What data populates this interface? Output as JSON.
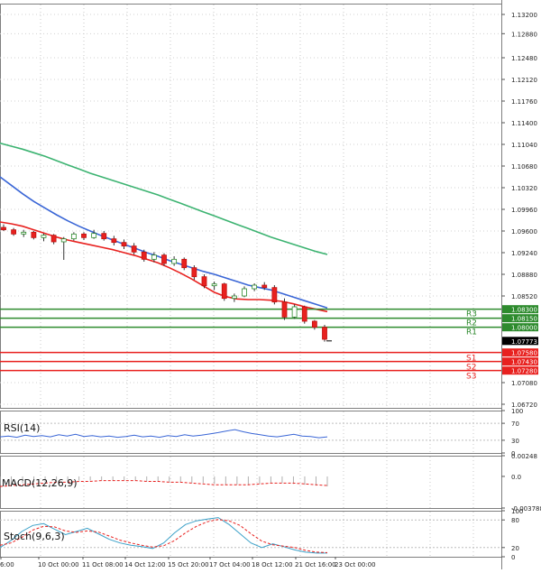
{
  "chart_data": {
    "type": "candlestick",
    "instrument_note": "",
    "main_panel": {
      "price_axis_ticks": [
        "1.13200",
        "1.12880",
        "1.12480",
        "1.12120",
        "1.11760",
        "1.11400",
        "1.11040",
        "1.10680",
        "1.10320",
        "1.09960",
        "1.09600",
        "1.09240",
        "1.08880",
        "1.08520"
      ],
      "price_axis_lower_ticks": [
        "1.07080",
        "1.06720"
      ],
      "ylim": [
        1.0666,
        1.1338
      ],
      "current_price": "1.07773",
      "levels": [
        {
          "label": "R3",
          "value": "1.08300",
          "color": "#2e8b2e"
        },
        {
          "label": "R2",
          "value": "1.08150",
          "color": "#2e8b2e"
        },
        {
          "label": "R1",
          "value": "1.08000",
          "color": "#2e8b2e"
        },
        {
          "label": "S1",
          "value": "1.07580",
          "color": "#e8211f"
        },
        {
          "label": "S2",
          "value": "1.07430",
          "color": "#e8211f"
        },
        {
          "label": "S3",
          "value": "1.07280",
          "color": "#e8211f"
        }
      ],
      "moving_averages": [
        {
          "color": "#e8211f",
          "values": [
            1.0975,
            1.0972,
            1.0968,
            1.0962,
            1.0956,
            1.095,
            1.0945,
            1.0941,
            1.0937,
            1.0933,
            1.0929,
            1.0924,
            1.0919,
            1.0913,
            1.0907,
            1.0899,
            1.089,
            1.088,
            1.0869,
            1.0858,
            1.0851,
            1.0847,
            1.0846,
            1.0846,
            1.0845,
            1.0843,
            1.0839,
            1.0834,
            1.083,
            1.0826
          ]
        },
        {
          "color": "#3a66d6",
          "values": [
            1.105,
            1.1036,
            1.1022,
            1.1009,
            1.0998,
            1.0987,
            1.0977,
            1.0968,
            1.096,
            1.0952,
            1.0945,
            1.0938,
            1.0931,
            1.0924,
            1.0918,
            1.0911,
            1.0905,
            1.0899,
            1.0893,
            1.0888,
            1.0882,
            1.0876,
            1.087,
            1.0866,
            1.0862,
            1.0856,
            1.085,
            1.0844,
            1.0838,
            1.0832
          ]
        },
        {
          "color": "#3cb371",
          "values": [
            1.1106,
            1.1101,
            1.1096,
            1.109,
            1.1084,
            1.1077,
            1.107,
            1.1063,
            1.1056,
            1.105,
            1.1044,
            1.1038,
            1.1032,
            1.1026,
            1.102,
            1.1013,
            1.1006,
            1.0999,
            1.0992,
            1.0985,
            1.0978,
            1.0971,
            1.0964,
            1.0957,
            1.095,
            1.0944,
            1.0938,
            1.0932,
            1.0926,
            1.0921
          ]
        }
      ],
      "candles": [
        {
          "o": 1.0966,
          "h": 1.0971,
          "l": 1.096,
          "c": 1.0962
        },
        {
          "o": 1.0962,
          "h": 1.0965,
          "l": 1.0952,
          "c": 1.0955
        },
        {
          "o": 1.0955,
          "h": 1.0962,
          "l": 1.095,
          "c": 1.0958
        },
        {
          "o": 1.0958,
          "h": 1.096,
          "l": 1.0946,
          "c": 1.0949
        },
        {
          "o": 1.0949,
          "h": 1.0956,
          "l": 1.0943,
          "c": 1.0953
        },
        {
          "o": 1.0953,
          "h": 1.0955,
          "l": 1.0938,
          "c": 1.0942
        },
        {
          "o": 1.0942,
          "h": 1.095,
          "l": 1.0912,
          "c": 1.0947
        },
        {
          "o": 1.0947,
          "h": 1.0958,
          "l": 1.0944,
          "c": 1.0955
        },
        {
          "o": 1.0955,
          "h": 1.0958,
          "l": 1.0945,
          "c": 1.0949
        },
        {
          "o": 1.0949,
          "h": 1.0962,
          "l": 1.0947,
          "c": 1.0956
        },
        {
          "o": 1.0956,
          "h": 1.096,
          "l": 1.0944,
          "c": 1.0947
        },
        {
          "o": 1.0947,
          "h": 1.0952,
          "l": 1.0936,
          "c": 1.0941
        },
        {
          "o": 1.0941,
          "h": 1.0946,
          "l": 1.093,
          "c": 1.0935
        },
        {
          "o": 1.0935,
          "h": 1.094,
          "l": 1.0921,
          "c": 1.0925
        },
        {
          "o": 1.0925,
          "h": 1.0929,
          "l": 1.0909,
          "c": 1.0913
        },
        {
          "o": 1.0913,
          "h": 1.0925,
          "l": 1.0908,
          "c": 1.092
        },
        {
          "o": 1.092,
          "h": 1.0923,
          "l": 1.0902,
          "c": 1.0906
        },
        {
          "o": 1.0906,
          "h": 1.0918,
          "l": 1.0902,
          "c": 1.0913
        },
        {
          "o": 1.0913,
          "h": 1.0916,
          "l": 1.0895,
          "c": 1.0899
        },
        {
          "o": 1.0899,
          "h": 1.0903,
          "l": 1.0879,
          "c": 1.0884
        },
        {
          "o": 1.0884,
          "h": 1.0888,
          "l": 1.0865,
          "c": 1.0869
        },
        {
          "o": 1.0869,
          "h": 1.0876,
          "l": 1.0862,
          "c": 1.0872
        },
        {
          "o": 1.0872,
          "h": 1.0874,
          "l": 1.0844,
          "c": 1.0848
        },
        {
          "o": 1.0848,
          "h": 1.0856,
          "l": 1.0842,
          "c": 1.0852
        },
        {
          "o": 1.0852,
          "h": 1.0868,
          "l": 1.085,
          "c": 1.0864
        },
        {
          "o": 1.0864,
          "h": 1.0873,
          "l": 1.086,
          "c": 1.087
        },
        {
          "o": 1.087,
          "h": 1.0875,
          "l": 1.0862,
          "c": 1.0866
        },
        {
          "o": 1.0866,
          "h": 1.087,
          "l": 1.0838,
          "c": 1.0842
        },
        {
          "o": 1.0842,
          "h": 1.0848,
          "l": 1.0812,
          "c": 1.0817
        },
        {
          "o": 1.0817,
          "h": 1.0838,
          "l": 1.0814,
          "c": 1.0834
        },
        {
          "o": 1.0834,
          "h": 1.0836,
          "l": 1.0806,
          "c": 1.081
        },
        {
          "o": 1.081,
          "h": 1.0812,
          "l": 1.0796,
          "c": 1.08
        },
        {
          "o": 1.08,
          "h": 1.0804,
          "l": 1.0776,
          "c": 1.078
        }
      ]
    },
    "rsi_panel": {
      "label": "RSI(14)",
      "ticks": [
        "100",
        "70",
        "30",
        "0"
      ],
      "ylim": [
        0,
        100
      ],
      "values": [
        38,
        40,
        37,
        42,
        39,
        41,
        38,
        43,
        40,
        44,
        39,
        41,
        38,
        40,
        37,
        39,
        42,
        38,
        40,
        37,
        41,
        39,
        43,
        40,
        42,
        45,
        48,
        52,
        55,
        50,
        46,
        43,
        40,
        38,
        41,
        44,
        40,
        39,
        36,
        38
      ]
    },
    "macd_panel": {
      "label": "MACD(12,26,9)",
      "ticks": [
        "0.00248",
        "0.0",
        "-0.003788"
      ],
      "ylim": [
        -0.003788,
        0.00248
      ],
      "histogram": [
        -0.001,
        -0.0009,
        -0.0008,
        -0.0007,
        -0.0007,
        -0.0006,
        -0.0006,
        -0.0005,
        -0.0005,
        -0.0005,
        -0.0005,
        -0.0005,
        -0.0005,
        -0.0006,
        -0.0006,
        -0.0007,
        -0.0007,
        -0.0008,
        -0.0008,
        -0.0009,
        -0.001,
        -0.001,
        -0.001,
        -0.0009,
        -0.0008,
        -0.0008,
        -0.0009,
        -0.001,
        -0.0011,
        -0.0012
      ],
      "signal": [
        -0.0012,
        -0.0011,
        -0.001,
        -0.0009,
        -0.0008,
        -0.0007,
        -0.0007,
        -0.0006,
        -0.0006,
        -0.0005,
        -0.0005,
        -0.0005,
        -0.0005,
        -0.0006,
        -0.0006,
        -0.0007,
        -0.0007,
        -0.0008,
        -0.0009,
        -0.001,
        -0.001,
        -0.001,
        -0.001,
        -0.0009,
        -0.0008,
        -0.0008,
        -0.0008,
        -0.0009,
        -0.001,
        -0.0011
      ]
    },
    "stoch_panel": {
      "label": "Stoch(9,6,3)",
      "ticks": [
        "100",
        "80",
        "20",
        "0"
      ],
      "ylim": [
        0,
        100
      ],
      "k": [
        20,
        35,
        55,
        68,
        72,
        60,
        48,
        55,
        62,
        50,
        38,
        30,
        25,
        22,
        18,
        30,
        52,
        70,
        78,
        82,
        85,
        70,
        50,
        30,
        20,
        28,
        22,
        15,
        10,
        8,
        8
      ],
      "d": [
        25,
        30,
        42,
        58,
        66,
        65,
        56,
        53,
        56,
        54,
        45,
        36,
        30,
        25,
        21,
        24,
        35,
        52,
        66,
        76,
        81,
        78,
        68,
        50,
        34,
        26,
        23,
        20,
        14,
        10,
        9
      ]
    },
    "time_axis_labels": [
      "6:00",
      "10 Oct 00:00",
      "11 Oct 08:00",
      "14 Oct 12:00",
      "15 Oct 20:00",
      "17 Oct 04:00",
      "18 Oct 12:00",
      "21 Oct 16:00",
      "23 Oct 00:00"
    ]
  }
}
